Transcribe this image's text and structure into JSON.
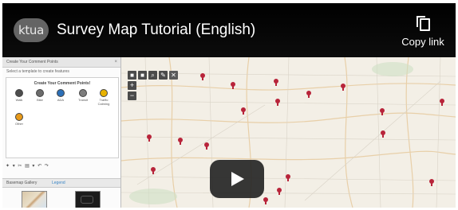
{
  "header": {
    "logo_text": "ktua",
    "title": "Survey Map Tutorial (English)",
    "copy_label": "Copy link"
  },
  "left_panel": {
    "top_title": "Create Your Comment Points",
    "subtitle": "Select a template to create features",
    "templates_title": "Create Your Comment Points!",
    "templates": [
      {
        "label": "Walk",
        "color": "#4d4d4d"
      },
      {
        "label": "Bike",
        "color": "#6b6b6b"
      },
      {
        "label": "ADA",
        "color": "#2c6fb7"
      },
      {
        "label": "Transit",
        "color": "#7d7d7d"
      },
      {
        "label": "Traffic Calming",
        "color": "#e7b200"
      },
      {
        "label": "Other",
        "color": "#e89a1a"
      }
    ],
    "tools_glyphs": "✦ ▾ ✂ ▤ ▾ ↶ ↷",
    "lower_tab_1": "Basemap Gallery",
    "lower_tab_2": "Legend"
  },
  "map": {
    "toolbar": [
      "■",
      "■",
      "⌕",
      "✎",
      "✕"
    ],
    "zoom_in": "+",
    "zoom_out": "−",
    "accent": "#b8243a"
  },
  "colors": {
    "pin": "#b8243a",
    "header_bg": "#000000",
    "play_bg": "#212121"
  },
  "icons": [
    "ktua-logo",
    "copy-icon",
    "play-icon",
    "pin-icon"
  ]
}
